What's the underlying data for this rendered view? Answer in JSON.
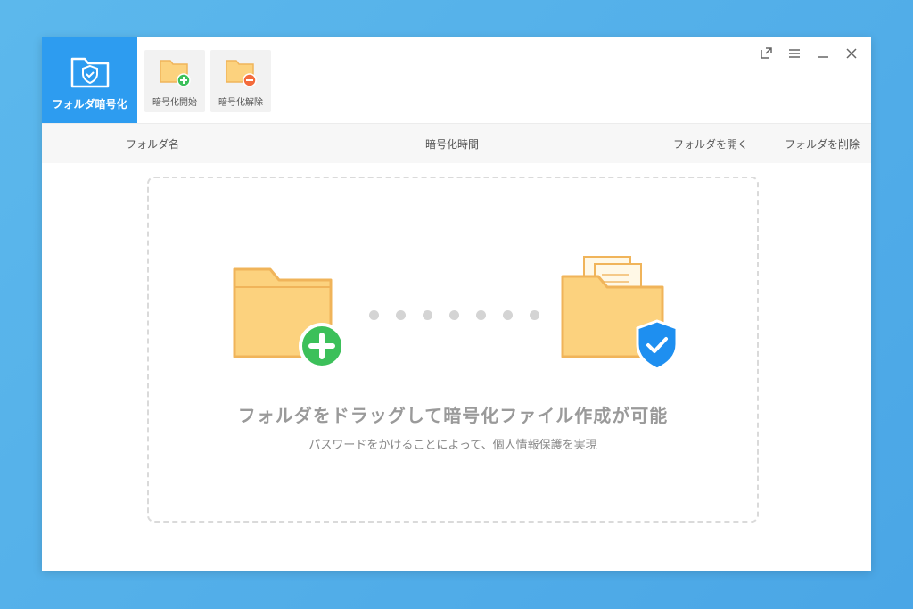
{
  "toolbar": {
    "brand_label": "フォルダ暗号化",
    "encrypt_start_label": "暗号化開始",
    "decrypt_label": "暗号化解除"
  },
  "window_controls": {
    "icons": [
      "export-icon",
      "menu-icon",
      "minimize-icon",
      "close-icon"
    ]
  },
  "table_header": {
    "folder_name": "フォルダ名",
    "encrypt_time": "暗号化時間",
    "open_folder": "フォルダを開く",
    "delete_folder": "フォルダを削除"
  },
  "drop_zone": {
    "title": "フォルダをドラッグして暗号化ファイル作成が可能",
    "subtitle": "パスワードをかけることによって、個人情報保護を実現"
  },
  "colors": {
    "brand_blue": "#2d9cf0",
    "folder_yellow": "#fcd27e",
    "folder_outline": "#f0b45a",
    "add_green": "#3cc05a",
    "shield_blue": "#1e8ff0"
  }
}
